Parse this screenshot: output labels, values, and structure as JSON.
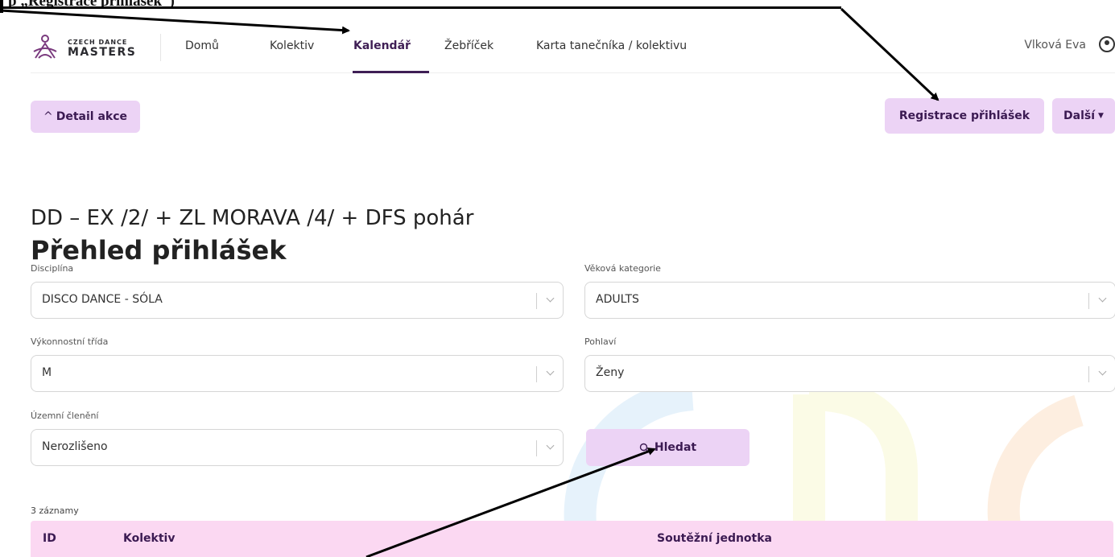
{
  "annotation": {
    "top_text": "p         „Registrace přihlášek“)"
  },
  "nav": {
    "logo_line1": "CZECH DANCE",
    "logo_line2": "MASTERS",
    "items": [
      {
        "label": "Domů"
      },
      {
        "label": "Kolektiv"
      },
      {
        "label": "Kalendář",
        "active": true
      },
      {
        "label": "Žebříček"
      },
      {
        "label": "Karta tanečníka / kolektivu"
      }
    ],
    "user_name": "Vlková Eva"
  },
  "toolbar": {
    "detail_label": "Detail akce",
    "registrace_label": "Registrace přihlášek",
    "dalsi_label": "Další"
  },
  "page": {
    "title": "Přehled přihlášek",
    "subtitle": "DD – EX /2/ + ZL MORAVA /4/ + DFS pohár"
  },
  "filters": {
    "disciplina": {
      "label": "Disciplína",
      "value": "DISCO DANCE - SÓLA"
    },
    "vekova": {
      "label": "Věková kategorie",
      "value": "ADULTS"
    },
    "vykonnostni": {
      "label": "Výkonnostní třída",
      "value": "M"
    },
    "pohlavi": {
      "label": "Pohlaví",
      "value": "Ženy"
    },
    "uzemni": {
      "label": "Územní členění",
      "value": "Nerozlišeno"
    },
    "search_label": "Hledat"
  },
  "table": {
    "count_label": "3 záznamy",
    "headers": {
      "id": "ID",
      "kolektiv": "Kolektiv",
      "jednotka": "Soutěžní jednotka"
    }
  },
  "colors": {
    "accent": "#ecd3f5",
    "brand_dark": "#3f1f55",
    "table_header": "#fbd8f2"
  }
}
